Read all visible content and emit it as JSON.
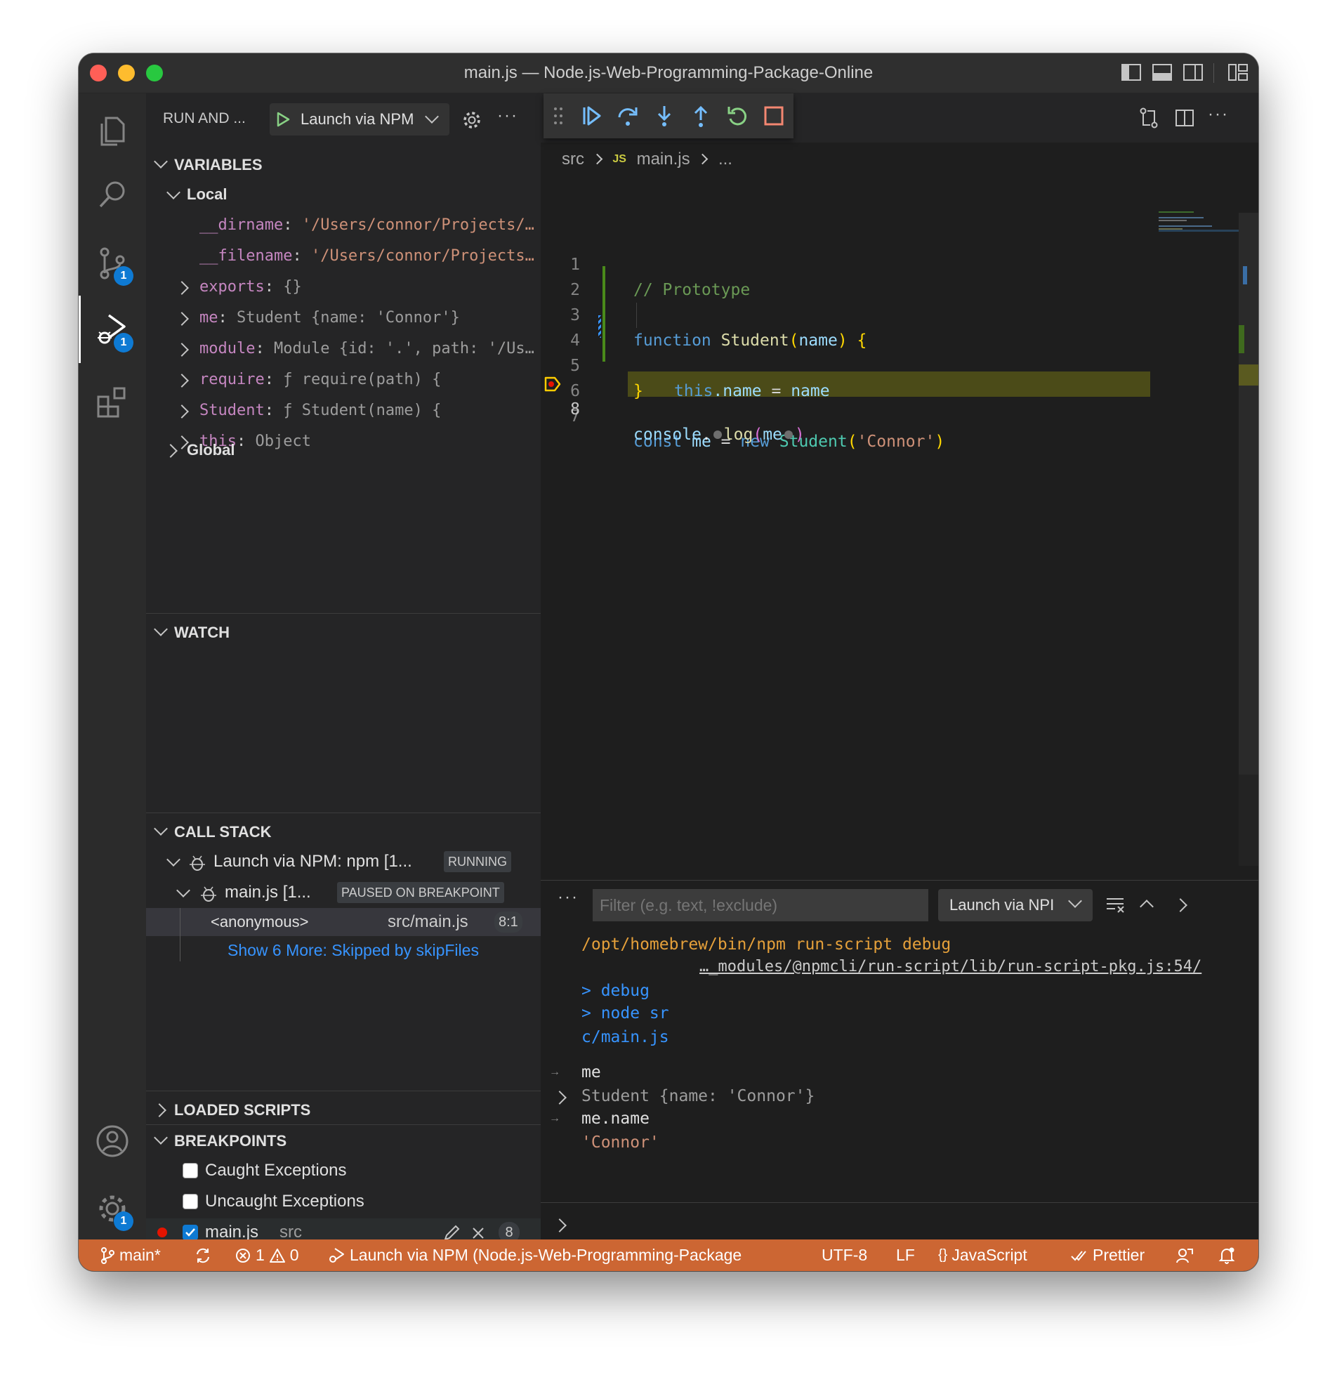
{
  "window": {
    "title": "main.js — Node.js-Web-Programming-Package-Online"
  },
  "activity_bar": {
    "items": [
      {
        "name": "explorer-icon"
      },
      {
        "name": "search-icon"
      },
      {
        "name": "source-control-icon",
        "badge": "1"
      },
      {
        "name": "run-and-debug-icon",
        "badge": "1"
      },
      {
        "name": "extensions-icon"
      }
    ],
    "bottom": [
      {
        "name": "accounts-icon"
      },
      {
        "name": "manage-gear-icon",
        "badge": "1"
      }
    ]
  },
  "sidebar": {
    "header_title": "RUN AND ...",
    "launch_config": "Launch via NPM",
    "variables": {
      "title": "VARIABLES",
      "local_label": "Local",
      "items": [
        {
          "name": "__dirname",
          "value": "'/Users/connor/Projects/…",
          "kind": "str",
          "expandable": false
        },
        {
          "name": "__filename",
          "value": "'/Users/connor/Projects…",
          "kind": "str",
          "expandable": false
        },
        {
          "name": "exports",
          "value": "{}",
          "kind": "obj",
          "expandable": true
        },
        {
          "name": "me",
          "value": "Student {name: 'Connor'}",
          "kind": "obj",
          "expandable": true
        },
        {
          "name": "module",
          "value": "Module {id: '.', path: '/Us…",
          "kind": "obj",
          "expandable": true
        },
        {
          "name": "require",
          "value": "ƒ require(path) {",
          "kind": "obj",
          "expandable": true
        },
        {
          "name": "Student",
          "value": "ƒ Student(name) {",
          "kind": "obj",
          "expandable": true
        },
        {
          "name": "this",
          "value": "Object",
          "kind": "obj",
          "expandable": true
        }
      ],
      "global_label": "Global"
    },
    "watch": {
      "title": "WATCH"
    },
    "call_stack": {
      "title": "CALL STACK",
      "session_label": "Launch via NPM: npm [1...",
      "session_status": "RUNNING",
      "thread_label": "main.js [1...",
      "thread_status": "PAUSED ON BREAKPOINT",
      "frame_name": "<anonymous>",
      "frame_file": "src/main.js",
      "frame_pos": "8:1",
      "skipped": "Show 6 More: Skipped by skipFiles"
    },
    "loaded_scripts": {
      "title": "LOADED SCRIPTS"
    },
    "breakpoints": {
      "title": "BREAKPOINTS",
      "caught": "Caught Exceptions",
      "uncaught": "Uncaught Exceptions",
      "file_name": "main.js",
      "file_dir": "src",
      "file_line": "8"
    }
  },
  "editor": {
    "breadcrumb": {
      "folder": "src",
      "file_badge": "JS",
      "file": "main.js",
      "more": "..."
    },
    "line_numbers": [
      "1",
      "2",
      "3",
      "4",
      "5",
      "6",
      "7",
      "8"
    ],
    "code": {
      "l1": "// Prototype",
      "l3_kw": "function",
      "l3_fn": "Student",
      "l3_paren_open": "(",
      "l3_param": "name",
      "l3_paren_close": ")",
      "l3_brace": "{",
      "l4_this": "this",
      "l4_dot_name": ".name",
      "l4_eq": " = ",
      "l4_val": "name",
      "l5_brace": "}",
      "l7_kw": "const",
      "l7_var": "me",
      "l7_eq": " = ",
      "l7_new": "new",
      "l7_fn": "Student",
      "l7_popen": "(",
      "l7_str": "'Connor'",
      "l7_pclose": ")",
      "l8_obj": "console",
      "l8_dot": ".",
      "l8_fn": "log",
      "l8_popen": "(",
      "l8_arg": "me",
      "l8_pclose": ")"
    }
  },
  "panel": {
    "filter_placeholder": "Filter (e.g. text, !exclude)",
    "session_select": "Launch via NPI",
    "lines": {
      "cmd": "/opt/homebrew/bin/npm run-script debug",
      "source_link": "…_modules/@npmcli/run-script/lib/run-script-pkg.js:54/",
      "debug": "> debug",
      "node": "> node sr",
      "node_cont": "c/main.js",
      "in1": "me",
      "out1": "Student {name: 'Connor'}",
      "in2": "me.name",
      "out2": "'Connor'"
    }
  },
  "status_bar": {
    "branch": "main*",
    "errors": "1",
    "warnings": "0",
    "debug_session": "Launch via NPM (Node.js-Web-Programming-Package",
    "encoding": "UTF-8",
    "eol": "LF",
    "language": "JavaScript",
    "formatter": "Prettier",
    "color": "#cc6633"
  }
}
